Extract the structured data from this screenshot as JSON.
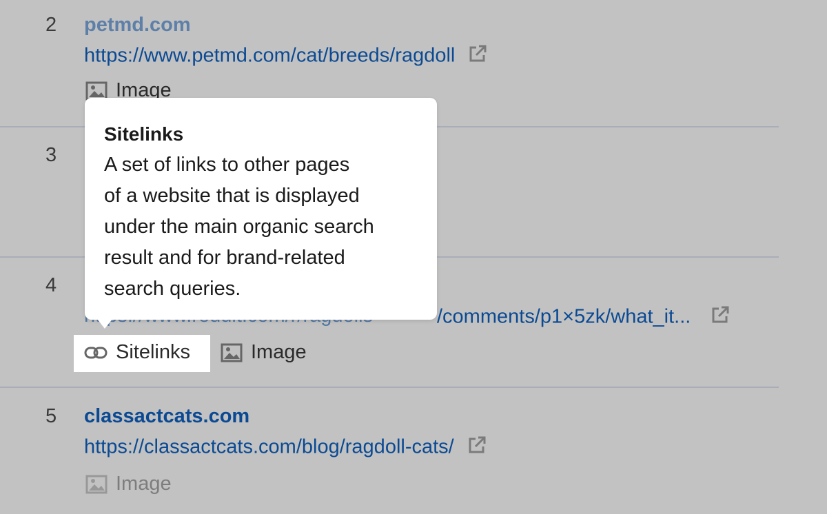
{
  "results": [
    {
      "rank": "2",
      "domain": "petmd.com",
      "url": "https://www.petmd.com/cat/breeds/ragdoll",
      "features": [
        "Image"
      ]
    },
    {
      "rank": "3"
    },
    {
      "rank": "4",
      "url_visible": "/comments/p1×5zk/what_it...",
      "url_obscured": "https://www.reddit.com/r/ragdolls",
      "features": [
        "Sitelinks",
        "Image"
      ]
    },
    {
      "rank": "5",
      "domain": "classactcats.com",
      "url": "https://classactcats.com/blog/ragdoll-cats/",
      "features": [
        "Image"
      ]
    }
  ],
  "tooltip": {
    "title": "Sitelinks",
    "lines": [
      "A set of links to other pages",
      "of a website that is displayed",
      "under the main organic search",
      "result and for brand-related",
      "search queries."
    ]
  },
  "icons": {
    "external": "external-link-icon",
    "image": "image-icon",
    "link": "link-icon"
  },
  "colors": {
    "overlay_bg": "#c2c2c2",
    "link": "#0b4a93",
    "tooltip_bg": "#ffffff"
  }
}
